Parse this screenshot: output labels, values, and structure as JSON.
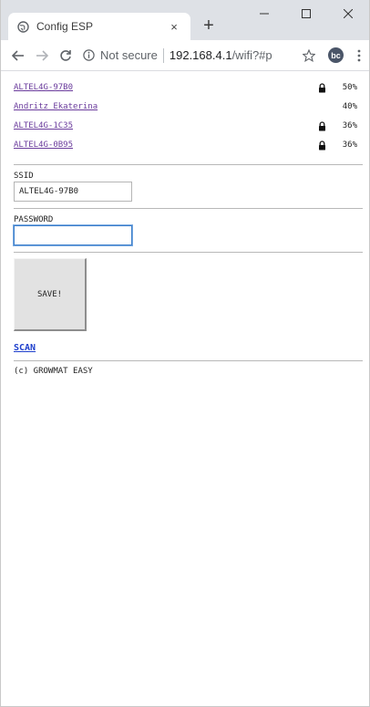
{
  "browser": {
    "tab": {
      "title": "Config ESP",
      "favicon": "globe-icon",
      "close_glyph": "×"
    },
    "new_tab_glyph": "+",
    "omnibox": {
      "security_label": "Not secure",
      "url_host": "192.168.4.1",
      "url_path": "/wifi?#p"
    },
    "profile_initials": "bc"
  },
  "networks": [
    {
      "ssid": "ALTEL4G-97B0",
      "locked": true,
      "signal": "50%"
    },
    {
      "ssid": "Andritz Ekaterina",
      "locked": false,
      "signal": "40%"
    },
    {
      "ssid": "ALTEL4G-1C35",
      "locked": true,
      "signal": "36%"
    },
    {
      "ssid": "ALTEL4G-0B95",
      "locked": true,
      "signal": "36%"
    }
  ],
  "form": {
    "ssid_label": "SSID",
    "ssid_value": "ALTEL4G-97B0",
    "password_label": "PASSWORD",
    "password_value": "",
    "save_label": "SAVE!",
    "scan_label": "SCAN"
  },
  "footer": {
    "text": "(c) GROWMAT EASY"
  },
  "colors": {
    "visited_link": "#6a3b9c",
    "scan_link": "#1e3fcc",
    "focus_border": "#3d7fcb",
    "tab_strip": "#dee1e6"
  }
}
